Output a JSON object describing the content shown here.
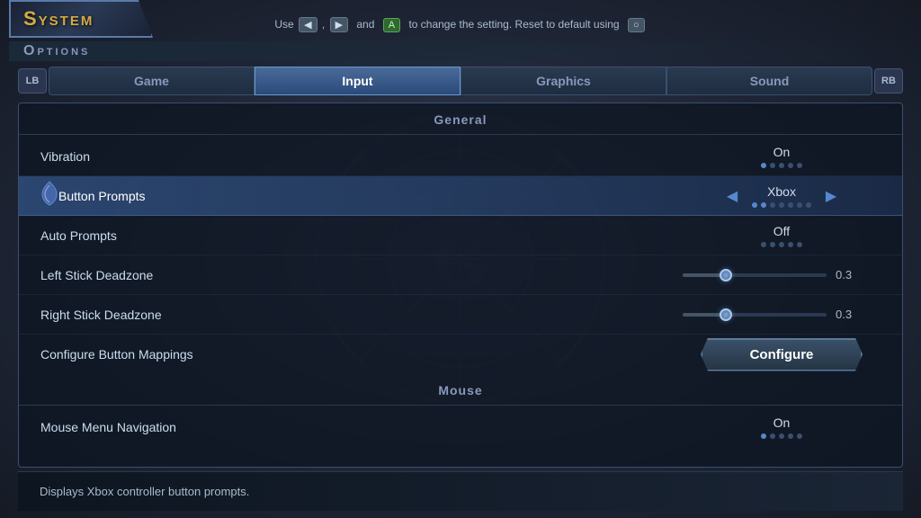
{
  "header": {
    "title": "System",
    "options_label": "Options",
    "hint": {
      "text_before": "Use",
      "btn1": "◀",
      "btn2": "▶",
      "text_middle": "and",
      "btn3": "A",
      "text_after": "to change the setting. Reset to default using",
      "btn4": "○"
    }
  },
  "tabs": {
    "shoulder_left": "LB",
    "shoulder_right": "RB",
    "items": [
      {
        "label": "Game",
        "active": false
      },
      {
        "label": "Input",
        "active": true
      },
      {
        "label": "Graphics",
        "active": false
      },
      {
        "label": "Sound",
        "active": false
      }
    ]
  },
  "sections": {
    "general": {
      "header": "General",
      "settings": [
        {
          "label": "Vibration",
          "type": "toggle",
          "value": "On",
          "dots": [
            true,
            false,
            false,
            false,
            false
          ]
        },
        {
          "label": "Button Prompts",
          "type": "select",
          "value": "Xbox",
          "highlighted": true
        },
        {
          "label": "Auto Prompts",
          "type": "toggle",
          "value": "Off",
          "dots": [
            false,
            false,
            false,
            false,
            false
          ]
        },
        {
          "label": "Left Stick Deadzone",
          "type": "slider",
          "value": "0.3",
          "percent": 30
        },
        {
          "label": "Right Stick Deadzone",
          "type": "slider",
          "value": "0.3",
          "percent": 30
        },
        {
          "label": "Configure Button Mappings",
          "type": "button",
          "button_label": "Configure"
        }
      ]
    },
    "mouse": {
      "header": "Mouse",
      "settings": [
        {
          "label": "Mouse Menu Navigation",
          "type": "toggle",
          "value": "On",
          "dots": [
            true,
            false,
            false,
            false,
            false
          ]
        }
      ]
    }
  },
  "description": "Displays Xbox controller button prompts.",
  "colors": {
    "accent": "#5588cc",
    "active_tab_bg": "#4a6a9a",
    "highlight_row": "rgba(60,100,160,0.6)",
    "gold": "#d4aa44"
  }
}
